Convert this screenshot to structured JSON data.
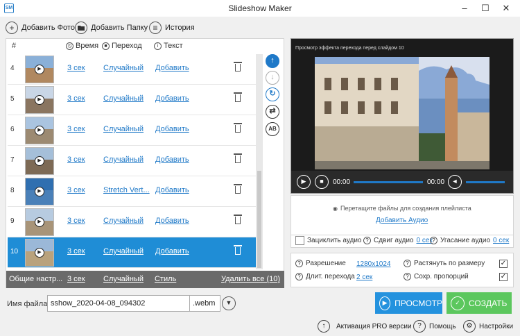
{
  "window": {
    "title": "Slideshow Maker",
    "app_icon": "ЅМ"
  },
  "toolbar": {
    "add_photo": "Добавить Фото",
    "add_folder": "Добавить Папку",
    "history": "История"
  },
  "table": {
    "headers": {
      "num": "#",
      "time": "Время",
      "transition": "Переход",
      "text": "Текст"
    },
    "rows": [
      {
        "num": "4",
        "time": "3 сек",
        "transition": "Случайный",
        "text": "Добавить",
        "selected": false
      },
      {
        "num": "5",
        "time": "3 сек",
        "transition": "Случайный",
        "text": "Добавить",
        "selected": false
      },
      {
        "num": "6",
        "time": "3 сек",
        "transition": "Случайный",
        "text": "Добавить",
        "selected": false
      },
      {
        "num": "7",
        "time": "3 сек",
        "transition": "Случайный",
        "text": "Добавить",
        "selected": false
      },
      {
        "num": "8",
        "time": "3 сек",
        "transition": "Stretch Vert...",
        "text": "Добавить",
        "selected": false
      },
      {
        "num": "9",
        "time": "3 сек",
        "transition": "Случайный",
        "text": "Добавить",
        "selected": false
      },
      {
        "num": "10",
        "time": "3 сек",
        "transition": "Случайный",
        "text": "Добавить",
        "selected": true
      }
    ],
    "footer": {
      "general": "Общие настр...",
      "time": "3 сек",
      "transition": "Случайный",
      "style": "Стиль",
      "delete_all": "Удалить все (10)"
    }
  },
  "preview": {
    "caption": "Просмотр эффекта перехода перед слайдом 10",
    "time_current": "00:00",
    "time_total": "00:00"
  },
  "playlist": {
    "drop_hint": "Перетащите файлы для создания плейлиста",
    "add_audio": "Добавить Аудио"
  },
  "audio": {
    "loop": "Зациклить аудио",
    "shift_label": "Сдвиг аудио",
    "shift_value": "0 сек",
    "fade_label": "Угасание аудио",
    "fade_value": "0 сек"
  },
  "settings": {
    "resolution_label": "Разрешение",
    "resolution_value": "1280x1024",
    "transition_len_label": "Длит. перехода",
    "transition_len_value": "2 сек",
    "stretch_label": "Растянуть по размеру",
    "keep_ratio_label": "Сохр. пропорций",
    "stretch_checked": true,
    "keep_ratio_checked": true
  },
  "file": {
    "label": "Имя файла:",
    "name": "sshow_2020-04-08_094302",
    "ext": ".webm"
  },
  "actions": {
    "preview": "ПРОСМОТР",
    "create": "СОЗДАТЬ"
  },
  "bottom": {
    "activate": "Активация PRO версии",
    "help": "Помощь",
    "settings": "Настройки"
  },
  "colors": {
    "accent": "#1f8dd6",
    "create": "#5cc75e",
    "footer": "#6a6a6a"
  }
}
